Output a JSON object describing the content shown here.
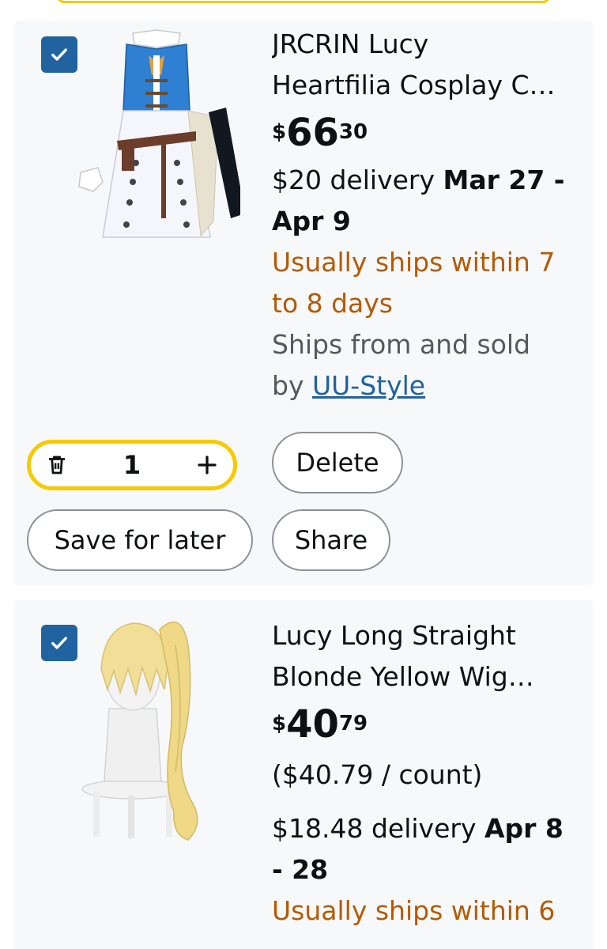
{
  "cart": {
    "items": [
      {
        "title_line1": "JRCRIN Lucy",
        "title_line2": "Heartfilia Cosplay C…",
        "price_currency": "$",
        "price_whole": "66",
        "price_fraction": "30",
        "delivery_prefix": "$20 delivery",
        "delivery_date_line1": "Mar 27 -",
        "delivery_date_line2": "Apr 9",
        "ships_line1": "Usually ships within 7",
        "ships_line2": "to 8 days",
        "seller_line1": "Ships from and sold",
        "seller_by": "by",
        "seller_name": "UU-Style",
        "quantity": "1",
        "delete_label": "Delete",
        "save_label": "Save for later",
        "share_label": "Share",
        "selected": true
      },
      {
        "title_line1": "Lucy Long Straight",
        "title_line2": "Blonde Yellow Wig…",
        "price_currency": "$",
        "price_whole": "40",
        "price_fraction": "79",
        "unit_price": "($40.79 / count)",
        "delivery_prefix": "$18.48 delivery",
        "delivery_date_line1": "Apr 8",
        "delivery_date_line2": "- 28",
        "ships_line1": "Usually ships within 6",
        "selected": true
      }
    ]
  },
  "colors": {
    "accent_yellow": "#f7ca00",
    "checkbox_blue": "#2162a1",
    "ships_orange": "#b65a00",
    "card_bg": "#f7f8fa"
  },
  "icons": {
    "checkbox": "checkmark-icon",
    "trash": "trash-icon",
    "plus": "plus-icon"
  }
}
